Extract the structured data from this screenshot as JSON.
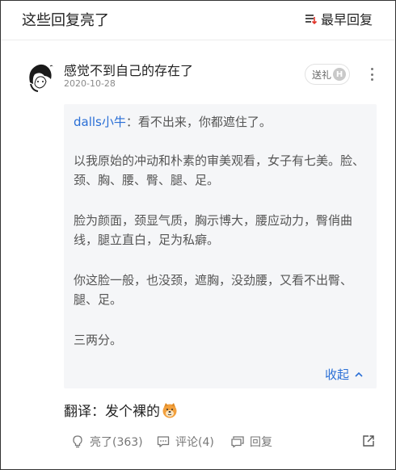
{
  "header": {
    "title": "这些回复亮了",
    "sort_label": "最早回复"
  },
  "comment": {
    "username": "感觉不到自己的存在了",
    "date": "2020-10-28",
    "gift_label": "送礼",
    "gift_badge": "H",
    "quote": {
      "mention": "dalls小牛",
      "mention_text": "：看不出来，你都遮住了。",
      "paragraph2": "以我原始的冲动和朴素的审美观看，女子有七美。脸、颈、胸、腰、臀、腿、足。",
      "paragraph3": "脸为颜面，颈显气质，胸示博大，腰应动力，臀俏曲线，腿立直白，足为私癖。",
      "paragraph4": "你这脸一般，也没颈，遮胸，没劲腰，又看不出臀、腿、足。",
      "paragraph5": "三两分。",
      "collapse_label": "收起"
    },
    "reply_text": "翻译：发个裸的",
    "actions": {
      "like_label": "亮了(363)",
      "comment_label": "评论(4)",
      "reply_label": "回复"
    }
  },
  "colors": {
    "link_blue": "#2a6fd6",
    "quote_bg": "#f5f6f8",
    "sort_icon_red": "#e0352b"
  }
}
